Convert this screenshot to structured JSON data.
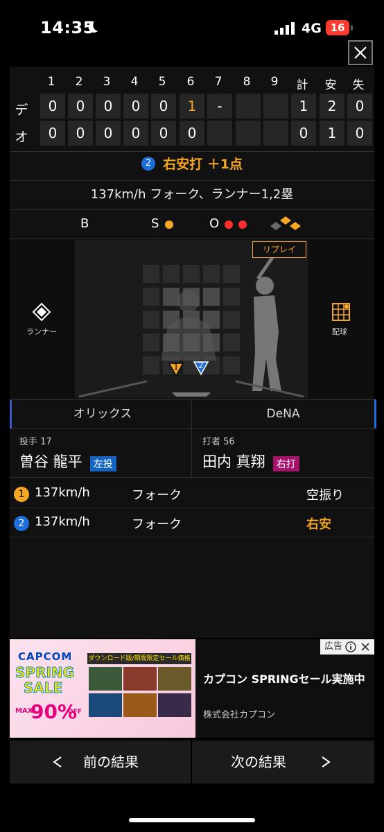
{
  "status_bar": {
    "time": "14:35",
    "network": "4G",
    "battery": "16"
  },
  "scoreboard": {
    "innings": [
      "1",
      "2",
      "3",
      "4",
      "5",
      "6",
      "7",
      "8",
      "9"
    ],
    "totals_headers": [
      "計",
      "安",
      "失"
    ],
    "teams": [
      {
        "abbr": "デ",
        "scores": [
          "0",
          "0",
          "0",
          "0",
          "0",
          "1",
          "-",
          "",
          ""
        ],
        "totals": [
          "1",
          "2",
          "0"
        ]
      },
      {
        "abbr": "オ",
        "scores": [
          "0",
          "0",
          "0",
          "0",
          "0",
          "0",
          "",
          "",
          ""
        ],
        "totals": [
          "0",
          "1",
          "0"
        ]
      }
    ]
  },
  "result": {
    "pitch_no": "2",
    "text": "右安打 ＋1点"
  },
  "pitch_description": "137km/h フォーク、ランナー1,2塁",
  "count": {
    "ball_label": "B",
    "strike_label": "S",
    "out_label": "O",
    "balls": 0,
    "strikes": 1,
    "outs": 2
  },
  "field": {
    "replay_label": "リプレイ",
    "runner_label": "ランナー",
    "pitch_chart_label": "配球",
    "markers": [
      "1",
      "2"
    ]
  },
  "teams_tabs": {
    "left": "オリックス",
    "right": "DeNA"
  },
  "pitcher": {
    "label": "投手 17",
    "name": "曽谷 龍平",
    "hand": "左投",
    "hand_color": "#1565c0"
  },
  "batter": {
    "label": "打者 56",
    "name": "田内 真翔",
    "hand": "右打",
    "hand_color": "#a3136a"
  },
  "pitches": [
    {
      "no": "1",
      "speed": "137km/h",
      "type": "フォーク",
      "result": "空振り",
      "color": "#f5a623"
    },
    {
      "no": "2",
      "speed": "137km/h",
      "type": "フォーク",
      "result": "右安",
      "color": "#1e6fd9"
    }
  ],
  "ad": {
    "tag": "広告",
    "brand": "CAPCOM",
    "headline1": "SPRING",
    "headline2": "SALE",
    "discount_prefix": "MAX",
    "discount": "90%",
    "discount_suffix": "OFF",
    "banner": "ダウンロード版/期間限定セール価格",
    "title": "カプコン SPRINGセール実施中",
    "company": "株式会社カプコン"
  },
  "nav": {
    "prev": "前の結果",
    "next": "次の結果"
  }
}
